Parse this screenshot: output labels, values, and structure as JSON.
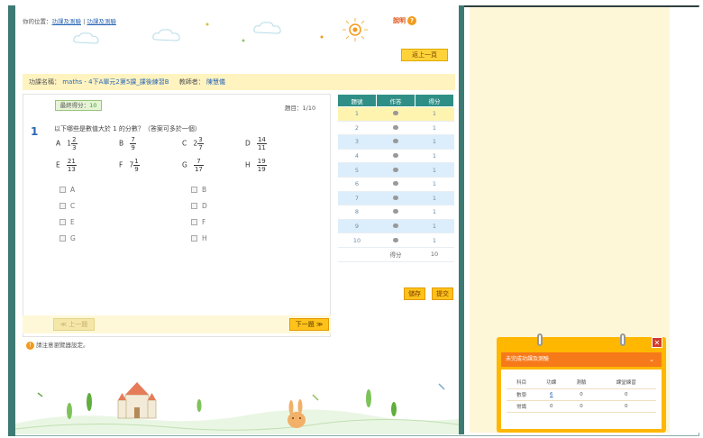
{
  "breadcrumb": {
    "prefix": "你的位置：",
    "link1": "功課及測驗",
    "separator": " | ",
    "link2": "功課及測驗"
  },
  "header": {
    "help_label": "說明",
    "help_icon": "question-icon",
    "back_label": "返上一頁"
  },
  "title_bar": {
    "name_label": "功課名稱：",
    "name_value": "maths - 4下A單元2第5課_課後練習B",
    "teacher_label": "教師者：",
    "teacher_value": "陳慧儀"
  },
  "question": {
    "score_label": "最終得分：",
    "score_value": "10",
    "progress": "題目：1/10",
    "number": "1",
    "text": "以下哪些是數值大於 1 的分數？（答案可多於一個）",
    "options": [
      {
        "letter": "A",
        "whole": "1",
        "num": "2",
        "den": "3"
      },
      {
        "letter": "B",
        "whole": "",
        "num": "7",
        "den": "9"
      },
      {
        "letter": "C",
        "whole": "2",
        "num": "3",
        "den": "7"
      },
      {
        "letter": "D",
        "whole": "",
        "num": "14",
        "den": "11"
      },
      {
        "letter": "E",
        "whole": "",
        "num": "21",
        "den": "13"
      },
      {
        "letter": "F",
        "whole": "7",
        "num": "1",
        "den": "9"
      },
      {
        "letter": "G",
        "whole": "",
        "num": "7",
        "den": "17"
      },
      {
        "letter": "H",
        "whole": "",
        "num": "19",
        "den": "19"
      }
    ],
    "choices": [
      "A",
      "B",
      "C",
      "D",
      "E",
      "F",
      "G",
      "H"
    ]
  },
  "nav": {
    "prev_label": "≪ 上一題",
    "next_label": "下一題 ≫"
  },
  "answer_table": {
    "headers": [
      "題號",
      "作答",
      "得分"
    ],
    "rows": [
      {
        "no": "1",
        "score": "1"
      },
      {
        "no": "2",
        "score": "1"
      },
      {
        "no": "3",
        "score": "1"
      },
      {
        "no": "4",
        "score": "1"
      },
      {
        "no": "5",
        "score": "1"
      },
      {
        "no": "6",
        "score": "1"
      },
      {
        "no": "7",
        "score": "1"
      },
      {
        "no": "8",
        "score": "1"
      },
      {
        "no": "9",
        "score": "1"
      },
      {
        "no": "10",
        "score": "1"
      }
    ],
    "total_label": "得分",
    "total_value": "10",
    "answer_icon": "dot-icon"
  },
  "actions": {
    "save_label": "儲存",
    "submit_label": "提交"
  },
  "notice": {
    "text": "請注意瀏覽器設定。"
  },
  "widget": {
    "title": "未完成功課及測驗",
    "close_label": "✕",
    "rows": [
      [
        "科目",
        "功課",
        "測驗",
        "課堂練習"
      ],
      [
        "數學",
        "6",
        "0",
        "0"
      ],
      [
        "常識",
        "0",
        "0",
        "0"
      ]
    ]
  },
  "colors": {
    "accent_teal": "#2f8f86",
    "button_yellow": "#ffc21a",
    "widget_orange": "#ffb700",
    "link_blue": "#2a67b5"
  }
}
